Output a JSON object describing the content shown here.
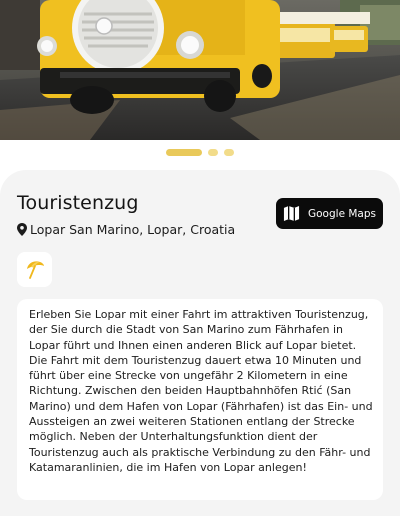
{
  "hero": {
    "image": "tourist-train-photo"
  },
  "carousel": {
    "slides": 3,
    "active_index": 0,
    "dot_color": "#e9c95a"
  },
  "attraction": {
    "title": "Touristenzug",
    "location": "Lopar San Marino, Lopar, Croatia",
    "maps_button_label": "Google Maps",
    "category_icon": "beach-umbrella-icon",
    "description": "Erleben Sie Lopar mit einer Fahrt im attraktiven Touristenzug, der Sie durch die Stadt von San Marino zum Fährhafen in Lopar führt und Ihnen einen anderen Blick auf Lopar bietet. Die Fahrt mit dem Touristenzug dauert etwa 10 Minuten und führt über eine Strecke von ungefähr 2 Kilometern in eine Richtung. Zwischen den beiden Hauptbahnhöfen Rtić (San Marino) und dem Hafen von Lopar (Fährhafen) ist das Ein- und Aussteigen an zwei weiteren Stationen entlang der Strecke möglich. Neben der Unterhaltungsfunktion dient der Touristenzug auch als praktische Verbindung zu den Fähr- und Katamaranlinien, die im Hafen von Lopar anlegen!"
  },
  "colors": {
    "accent": "#f0c020",
    "button_bg": "#0b0b0b",
    "sheet_bg": "#f4f4f4"
  }
}
